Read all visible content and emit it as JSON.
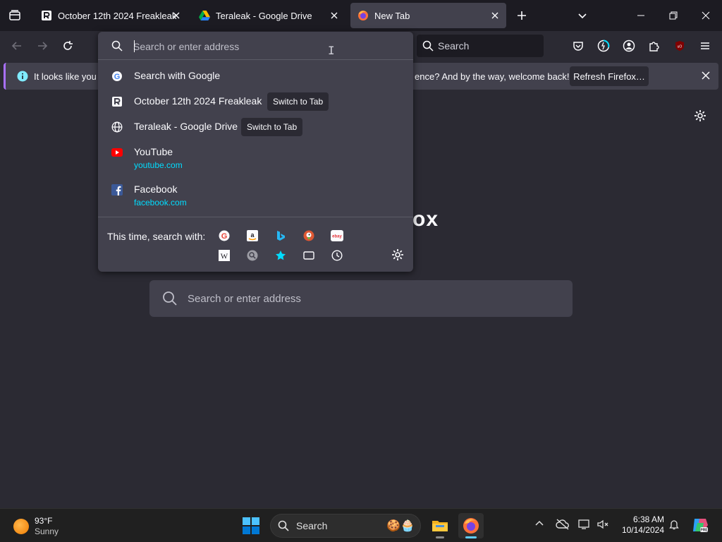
{
  "tabs": [
    {
      "title": "October 12th 2024 Freakleak",
      "active": false
    },
    {
      "title": "Teraleak - Google Drive",
      "active": false
    },
    {
      "title": "New Tab",
      "active": true
    }
  ],
  "toolbar": {
    "search_placeholder": "Search"
  },
  "notification": {
    "message_start": "It looks like you ha",
    "message_end": "ence? And by the way, welcome back!",
    "refresh_label": "Refresh Firefox…"
  },
  "urlbar": {
    "placeholder": "Search or enter address",
    "results": [
      {
        "title": "Search with Google",
        "icon": "google-icon"
      },
      {
        "title": "October 12th 2024 Freakleak",
        "action": "Switch to Tab",
        "icon": "r-favicon-icon"
      },
      {
        "title": "Teraleak - Google Drive",
        "action": "Switch to Tab",
        "icon": "globe-icon"
      },
      {
        "title": "YouTube",
        "url": "youtube.com",
        "icon": "youtube-icon"
      },
      {
        "title": "Facebook",
        "url": "facebook.com",
        "icon": "facebook-icon"
      }
    ],
    "search_with_label": "This time, search with:"
  },
  "newtab": {
    "logo_partial": "ox",
    "search_placeholder": "Search or enter address"
  },
  "taskbar": {
    "weather_temp": "93°F",
    "weather_cond": "Sunny",
    "search_label": "Search",
    "time": "6:38 AM",
    "date": "10/14/2024"
  },
  "colors": {
    "accent": "#00ddff",
    "panel": "#42414d",
    "background": "#2b2a33",
    "tabstrip": "#1c1b22"
  }
}
